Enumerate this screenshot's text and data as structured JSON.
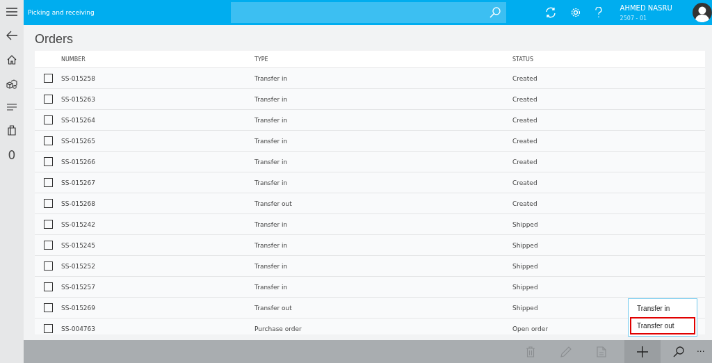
{
  "app_title": "Picking and receiving",
  "user": {
    "name": "AHMED NASRU",
    "code": "2507 - 01"
  },
  "rail": {
    "count": "0"
  },
  "page_title": "Orders",
  "table": {
    "columns": [
      "NUMBER",
      "TYPE",
      "STATUS"
    ],
    "rows": [
      {
        "number": "SS-015258",
        "type": "Transfer in",
        "status": "Created",
        "checked": false
      },
      {
        "number": "SS-015263",
        "type": "Transfer in",
        "status": "Created",
        "checked": false
      },
      {
        "number": "SS-015264",
        "type": "Transfer in",
        "status": "Created",
        "checked": false
      },
      {
        "number": "SS-015265",
        "type": "Transfer in",
        "status": "Created",
        "checked": false
      },
      {
        "number": "SS-015266",
        "type": "Transfer in",
        "status": "Created",
        "checked": false
      },
      {
        "number": "SS-015267",
        "type": "Transfer in",
        "status": "Created",
        "checked": false
      },
      {
        "number": "SS-015268",
        "type": "Transfer out",
        "status": "Created",
        "checked": false
      },
      {
        "number": "SS-015242",
        "type": "Transfer in",
        "status": "Shipped",
        "checked": false
      },
      {
        "number": "SS-015245",
        "type": "Transfer in",
        "status": "Shipped",
        "checked": false
      },
      {
        "number": "SS-015252",
        "type": "Transfer in",
        "status": "Shipped",
        "checked": false
      },
      {
        "number": "SS-015257",
        "type": "Transfer in",
        "status": "Shipped",
        "checked": false
      },
      {
        "number": "SS-015269",
        "type": "Transfer out",
        "status": "Shipped",
        "checked": false
      },
      {
        "number": "SS-004763",
        "type": "Purchase order",
        "status": "Open order",
        "checked": false
      }
    ]
  },
  "new_menu": {
    "items": [
      {
        "label": "Transfer in",
        "selected": false
      },
      {
        "label": "Transfer out",
        "selected": true
      }
    ]
  },
  "action_bar": {
    "more": "···"
  }
}
